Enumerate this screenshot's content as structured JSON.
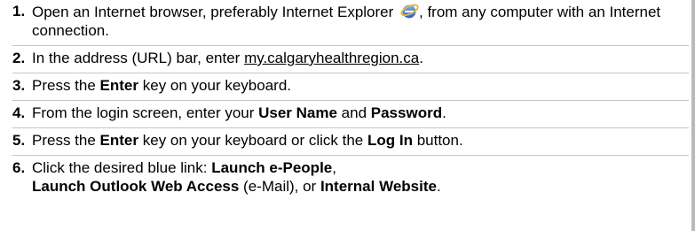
{
  "steps": [
    {
      "num": "1.",
      "t1": "Open an Internet browser, preferably Internet Explorer ",
      "t2": ", from any computer with an Internet connection.",
      "icon": "internet-explorer-icon"
    },
    {
      "num": "2.",
      "t1": "In the address (URL) bar, enter ",
      "url": "my.calgaryhealthregion.ca",
      "t2": "."
    },
    {
      "num": "3.",
      "t1": "Press the ",
      "b1": "Enter",
      "t2": " key on your keyboard."
    },
    {
      "num": "4.",
      "t1": "From the login screen, enter your ",
      "b1": "User Name",
      "t2": " and ",
      "b2": "Password",
      "t3": "."
    },
    {
      "num": "5.",
      "t1": "Press the ",
      "b1": "Enter",
      "t2": " key on your keyboard or click the ",
      "b2": "Log In",
      "t3": " button."
    },
    {
      "num": "6.",
      "t1": "Click the desired blue link:  ",
      "b1": "Launch e-People",
      "t2": ",",
      "b2": "Launch Outlook Web Access",
      "t3": " (e-Mail), or ",
      "b3": "Internal Website",
      "t4": "."
    }
  ],
  "colors": {
    "ie_blue": "#2b6fd6",
    "ie_ring": "#e8b23a",
    "divider": "#c6c6c6",
    "right_rule": "#b9b9b9"
  }
}
